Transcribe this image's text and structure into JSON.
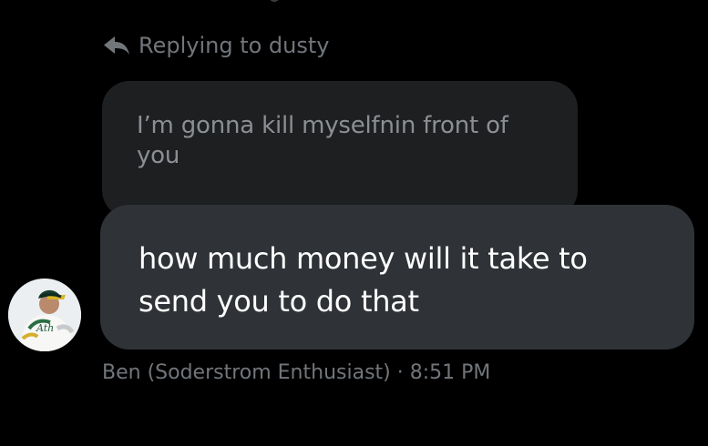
{
  "reply_context": {
    "icon": "reply-arrow-icon",
    "text": "Replying to dusty"
  },
  "quoted_message": {
    "text": "I’m gonna kill myselfnin front of you"
  },
  "reply_message": {
    "text": "how much money will it take to send you to do that"
  },
  "sender": {
    "avatar": "baseball-player-avatar",
    "name": "Ben (Soderstrom Enthusiast)",
    "separator": "·",
    "time": "8:51 PM"
  },
  "colors": {
    "background": "#000000",
    "quoted_bubble": "#1e1f21",
    "reply_bubble": "#2f3236",
    "muted_text": "#71767b",
    "bubble_text": "#ffffff"
  }
}
